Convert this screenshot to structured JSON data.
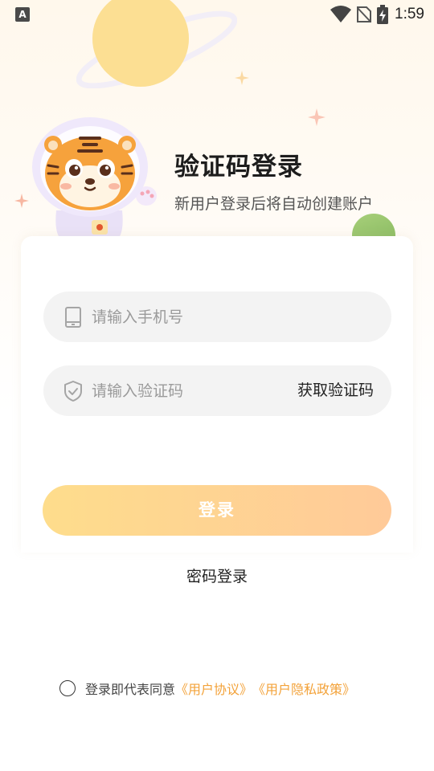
{
  "status_bar": {
    "app_icon_letter": "A",
    "time": "1:59"
  },
  "header": {
    "title": "验证码登录",
    "subtitle": "新用户登录后将自动创建账户"
  },
  "form": {
    "phone_placeholder": "请输入手机号",
    "code_placeholder": "请输入验证码",
    "get_code_label": "获取验证码",
    "login_label": "登录"
  },
  "password_login_label": "密码登录",
  "agreement": {
    "prefix": "登录即代表同意",
    "user_agreement": "《用户协议》",
    "privacy_policy": "《用户隐私政策》"
  },
  "colors": {
    "accent": "#f3a239",
    "button_start": "#fedd8c",
    "button_end": "#ffca99",
    "background": "#fff8ec"
  }
}
